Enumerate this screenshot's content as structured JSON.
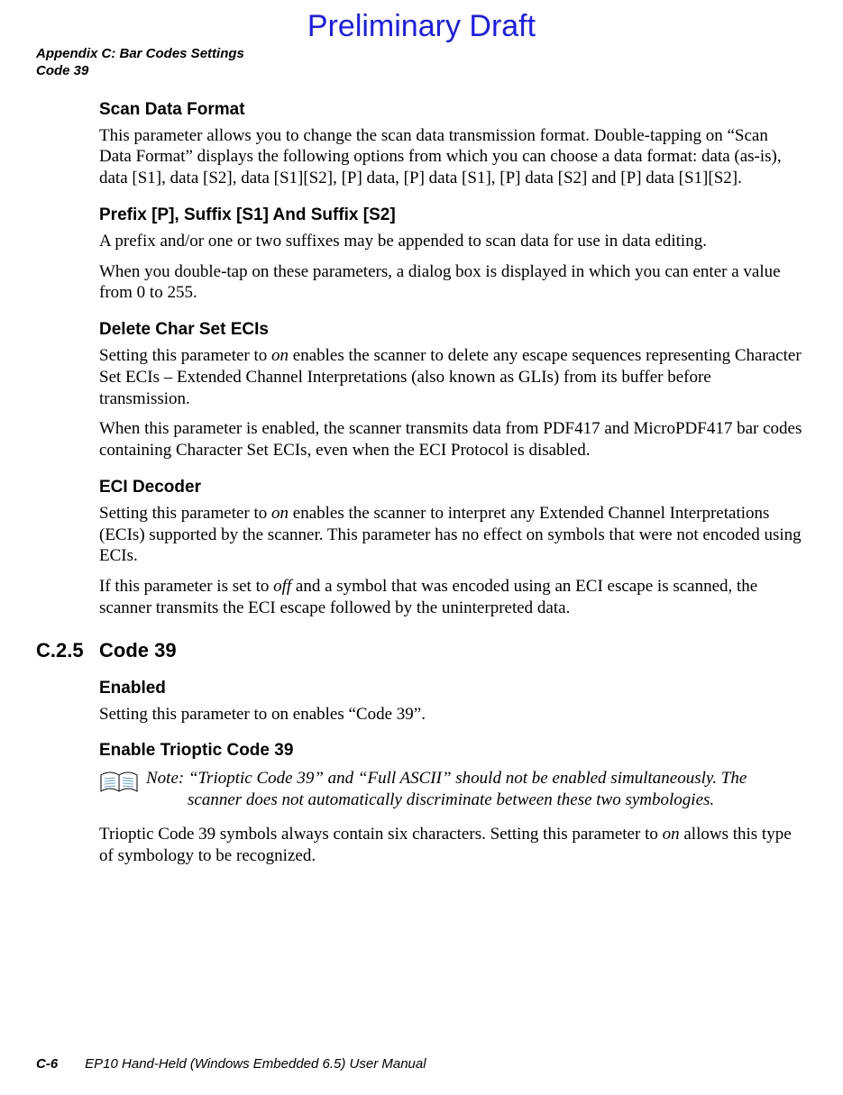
{
  "watermark": "Preliminary Draft",
  "header": {
    "line1": "Appendix C: Bar Codes Settings",
    "line2": "Code 39"
  },
  "sections": {
    "scan_data_format": {
      "title": "Scan Data Format",
      "p1": "This parameter allows you to change the scan data transmission format. Double-tapping on “Scan Data Format” displays the following options from which you can choose a data format: data (as-is), data [S1], data [S2], data [S1][S2], [P] data, [P] data [S1], [P] data [S2] and [P] data [S1][S2]."
    },
    "prefix_suffix": {
      "title": "Prefix [P], Suffix [S1] And Suffix [S2]",
      "p1": "A prefix and/or one or two suffixes may be appended to scan data for use in data editing.",
      "p2": "When you double-tap on these parameters, a dialog box is displayed in which you can enter a value from 0 to 255."
    },
    "delete_ecis": {
      "title": "Delete Char Set ECIs",
      "p1a": "Setting this parameter to ",
      "p1b": "on",
      "p1c": " enables the scanner to delete any escape sequences representing Character Set ECIs – Extended Channel Interpretations (also known as GLIs) from its buffer before transmission.",
      "p2": "When this parameter is enabled, the scanner transmits data from PDF417 and MicroPDF417 bar codes containing Character Set ECIs, even when the ECI Protocol is disabled."
    },
    "eci_decoder": {
      "title": "ECI Decoder",
      "p1a": "Setting this parameter to ",
      "p1b": "on",
      "p1c": " enables the scanner to interpret any Extended Channel Interpretations (ECIs) supported by the scanner. This parameter has no effect on symbols that were not encoded using ECIs.",
      "p2a": "If this parameter is set to ",
      "p2b": "off",
      "p2c": " and a symbol that was encoded using an ECI escape is scanned, the scanner transmits the ECI escape followed by the uninterpreted data."
    },
    "code39": {
      "number": "C.2.5",
      "title": "Code 39",
      "enabled": {
        "title": "Enabled",
        "p1": "Setting this parameter to on enables “Code 39”."
      },
      "trioptic": {
        "title": "Enable Trioptic Code 39",
        "note_label": "Note:",
        "note_body1": "“Trioptic Code 39” and “Full ASCII” should not be enabled simultaneously. The",
        "note_body2": "scanner does not automatically discriminate between these two symbologies.",
        "p1a": "Trioptic Code 39 symbols always contain six characters. Setting this parameter to ",
        "p1b": "on",
        "p1c": " allows this type of symbology to be recognized."
      }
    }
  },
  "footer": {
    "page": "C-6",
    "manual": "EP10 Hand-Held (Windows Embedded 6.5) User Manual"
  }
}
